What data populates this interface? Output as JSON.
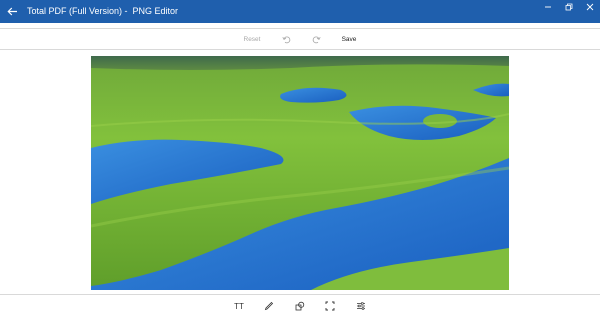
{
  "window": {
    "title": "Total PDF (Full Version) -  PNG Editor",
    "back_icon": "arrow-left-icon",
    "controls": [
      "minimize-icon",
      "restore-icon",
      "close-icon"
    ]
  },
  "toolbar_top": {
    "reset_label": "Reset",
    "reset_enabled": false,
    "undo_icon": "undo-icon",
    "undo_enabled": false,
    "redo_icon": "redo-icon",
    "redo_enabled": false,
    "save_label": "Save"
  },
  "image": {
    "subject": "marsh wetland with blue ponds and green grass"
  },
  "toolbar_bottom": {
    "tools": [
      {
        "name": "text",
        "icon": "text-tool-icon",
        "glyph": "TT"
      },
      {
        "name": "draw",
        "icon": "pen-icon"
      },
      {
        "name": "shapes",
        "icon": "shapes-icon"
      },
      {
        "name": "crop",
        "icon": "crop-icon"
      },
      {
        "name": "adjust",
        "icon": "adjust-sliders-icon"
      }
    ]
  },
  "colors": {
    "titlebar": "#1f5fad",
    "toolbar_border": "#d9d9d9",
    "disabled_text": "#a8a8a8"
  }
}
